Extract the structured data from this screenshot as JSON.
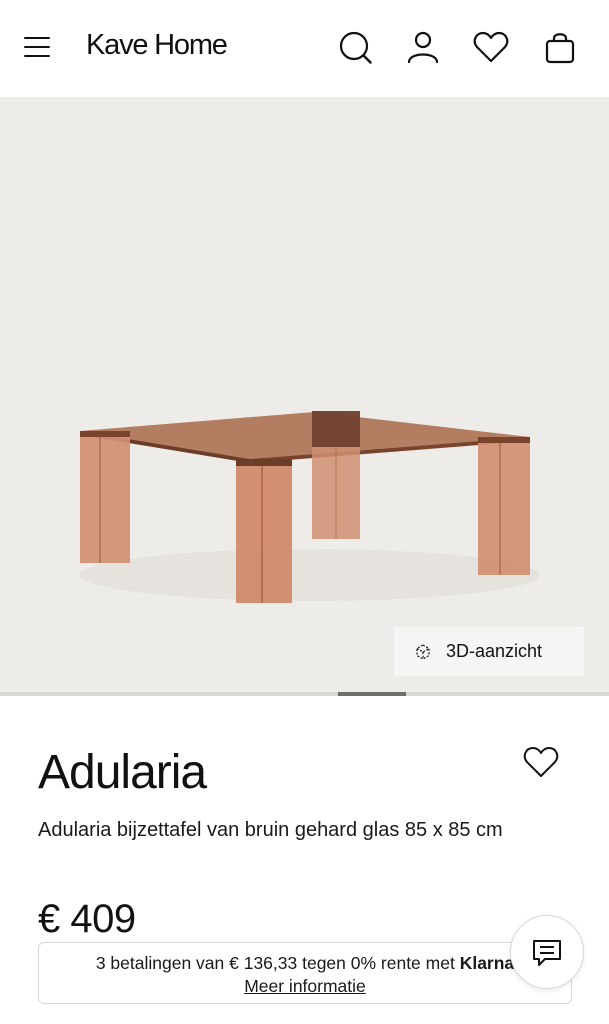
{
  "header": {
    "logo": "Kave Home",
    "icons": [
      "menu-icon",
      "search-icon",
      "account-icon",
      "wishlist-icon",
      "bag-icon"
    ]
  },
  "gallery": {
    "view_3d_label": "3D-aanzicht",
    "background": "#eeece8",
    "active_slide_indicator": "position 5 of 9"
  },
  "product": {
    "name": "Adularia",
    "description": "Adularia bijzettafel van bruin gehard glas 85 x 85 cm",
    "price": "€ 409",
    "color": "#b8663f"
  },
  "klarna": {
    "text": "3 betalingen van € 136,33 tegen 0% rente met ",
    "brand": "Klarna",
    "more": "Meer informatie"
  },
  "chat": {
    "icon": "chat-icon"
  }
}
